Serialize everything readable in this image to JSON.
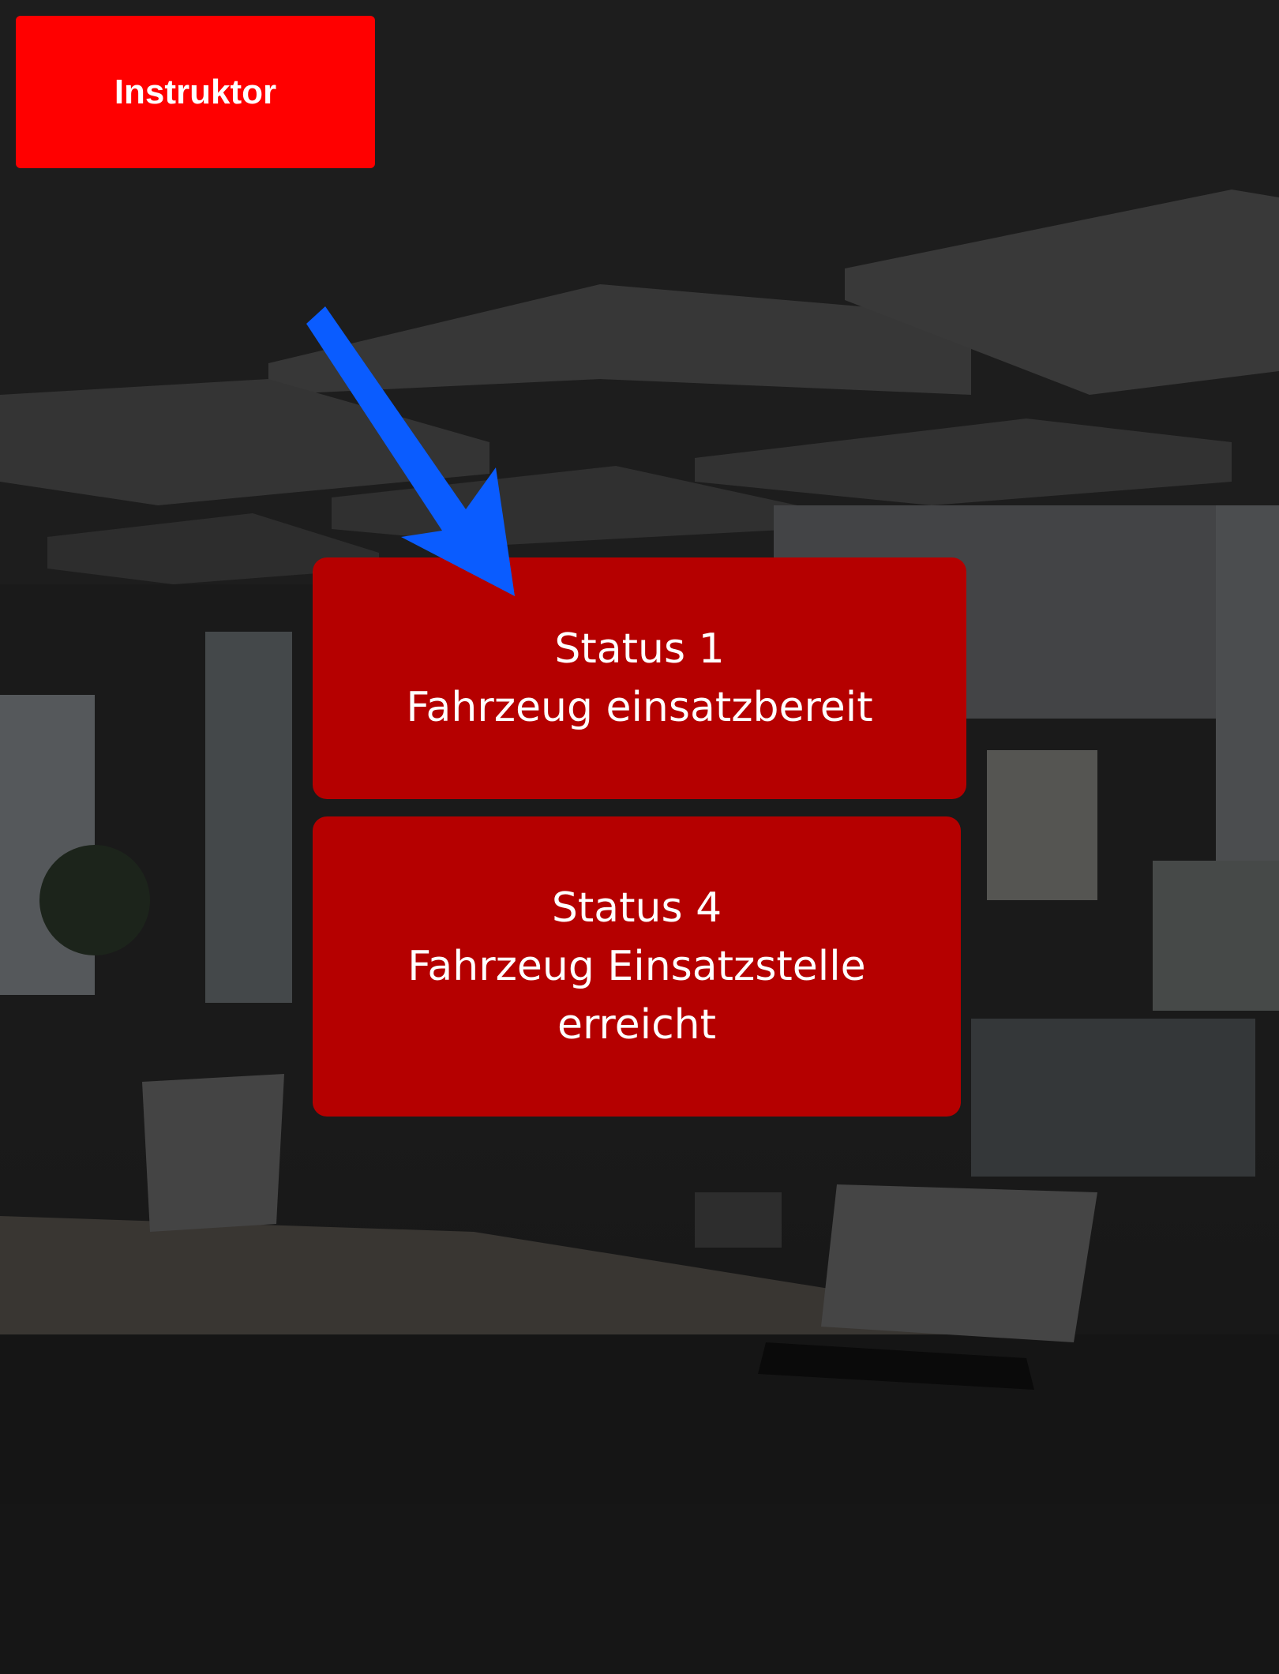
{
  "instructor_button": {
    "label": "Instruktor",
    "color": "#ff0000"
  },
  "status_buttons": [
    {
      "title": "Status 1",
      "line1": "Fahrzeug einsatzbereit",
      "line2": ""
    },
    {
      "title": "Status 4",
      "line1": "Fahrzeug Einsatzstelle",
      "line2": "erreicht"
    }
  ],
  "colors": {
    "status_button": "#b50000",
    "arrow": "#0a5cff",
    "overlay": "rgba(0,0,0,0.55)"
  },
  "icons": {
    "pointer": "arrow-down-right-icon"
  }
}
